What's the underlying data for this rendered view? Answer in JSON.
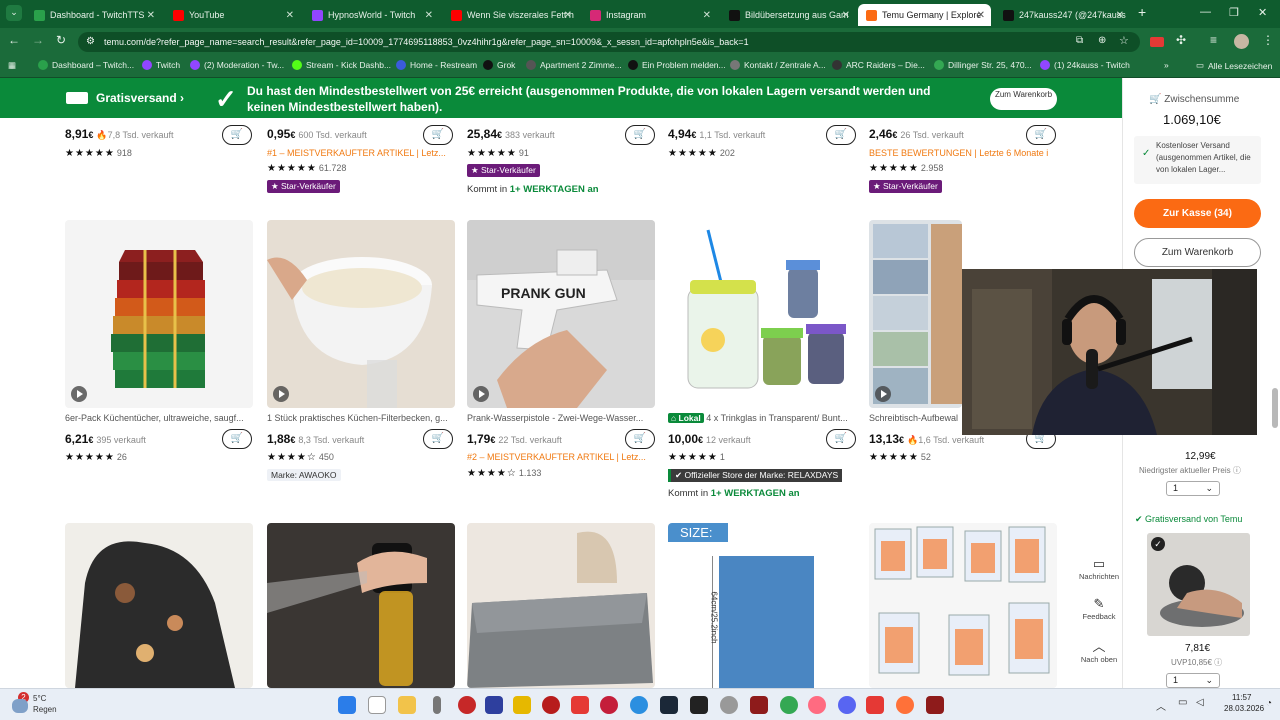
{
  "browser": {
    "tabs": [
      {
        "title": "Dashboard - TwitchTTS",
        "color": "#2aa14b"
      },
      {
        "title": "YouTube",
        "color": "#ff0000"
      },
      {
        "title": "HypnosWorld - Twitch",
        "color": "#9146ff"
      },
      {
        "title": "Wenn Sie viszerales Fett h",
        "color": "#ff0000"
      },
      {
        "title": "Instagram",
        "color": "#d62976"
      },
      {
        "title": "Bildübersetzung aus Gam",
        "color": "#111111"
      },
      {
        "title": "Temu Germany | Explore",
        "color": "#fb6a13"
      },
      {
        "title": "247kauss247 (@247kauss",
        "color": "#111111"
      }
    ],
    "url": "temu.com/de?refer_page_name=search_result&refer_page_id=10009_1774695118853_0vz4hihr1g&refer_page_sn=10009&_x_sessn_id=apfohpln5e&is_back=1",
    "bookmarks": [
      {
        "label": "Dashboard – Twitch...",
        "color": "#2aa14b"
      },
      {
        "label": "Twitch",
        "color": "#9146ff"
      },
      {
        "label": "(2) Moderation - Tw...",
        "color": "#9146ff"
      },
      {
        "label": "Stream - Kick Dashb...",
        "color": "#53fc18"
      },
      {
        "label": "Home - Restream",
        "color": "#3b5bdb"
      },
      {
        "label": "Grok",
        "color": "#111111"
      },
      {
        "label": "Apartment 2 Zimme...",
        "color": "#555555"
      },
      {
        "label": "Ein Problem melden...",
        "color": "#111111"
      },
      {
        "label": "Kontakt / Zentrale A...",
        "color": "#777777"
      },
      {
        "label": "ARC Raiders – Die...",
        "color": "#333333"
      },
      {
        "label": "Dillinger Str. 25, 470...",
        "color": "#34a853"
      },
      {
        "label": "(1) 24kauss - Twitch",
        "color": "#9146ff"
      }
    ],
    "bookmarks_more": "»",
    "all_bookmarks": "Alle Lesezeichen"
  },
  "banner": {
    "left": "Gratisversand",
    "message": "Du hast den Mindestbestellwert von 25€ erreicht (ausgenommen Produkte, die von lokalen Lagern versandt werden und keinen Mindestbestellwert haben).",
    "cart_button": "Zum Warenkorb"
  },
  "top_row": [
    {
      "price_main": "8,91",
      "price_unit": "€",
      "sold": "7,8 Tsd. verkauft",
      "reviews": "918",
      "cart_icon": "cart-plus-icon"
    },
    {
      "price_main": "0,95",
      "price_unit": "€",
      "sold": "600 Tsd. verkauft",
      "badge": "#1 – MEISTVERKAUFTER ARTIKEL | Letz...",
      "reviews": "61.728",
      "star_seller": "Star-Verkäufer"
    },
    {
      "price_main": "25,84",
      "price_unit": "€",
      "sold": "383 verkauft",
      "reviews": "91",
      "star_seller": "Star-Verkäufer",
      "delivery_prefix": "Kommt in",
      "delivery_days": "1+ WERKTAGEN an"
    },
    {
      "price_main": "4,94",
      "price_unit": "€",
      "sold": "1,1 Tsd. verkauft",
      "reviews": "202"
    },
    {
      "price_main": "2,46",
      "price_unit": "€",
      "sold": "26 Tsd. verkauft",
      "badge": "BESTE BEWERTUNGEN | Letzte 6 Monate i",
      "reviews": "2.958",
      "star_seller": "Star-Verkäufer"
    }
  ],
  "middle_row": [
    {
      "title": "6er-Pack Küchentücher, ultraweiche, saugf...",
      "price_main": "6,21",
      "price_unit": "€",
      "sold": "395 verkauft",
      "reviews": "26"
    },
    {
      "title": "1 Stück praktisches Küchen-Filterbecken, g...",
      "price_main": "1,88",
      "price_unit": "€",
      "sold": "8,3 Tsd. verkauft",
      "reviews": "450",
      "brand": "Marke: AWAOKO"
    },
    {
      "title": "Prank-Wasserpistole - Zwei-Wege-Wasser...",
      "price_main": "1,79",
      "price_unit": "€",
      "sold": "22 Tsd. verkauft",
      "badge": "#2 – MEISTVERKAUFTER ARTIKEL | Letz...",
      "reviews": "1.133",
      "gun_text": "PRANK GUN"
    },
    {
      "local_tag": "Lokal",
      "title": "4 x Trinkglas in Transparent/ Bunt...",
      "price_main": "10,00",
      "price_unit": "€",
      "sold": "12 verkauft",
      "reviews": "1",
      "official_store": "Offizieller Store der Marke: RELAXDAYS",
      "delivery_prefix": "Kommt in",
      "delivery_days": "1+ WERKTAGEN an"
    },
    {
      "title": "Schreibtisch-Aufbewal",
      "price_main": "13,13",
      "price_unit": "€",
      "sold": "1,6 Tsd. verkauft",
      "reviews": "52"
    }
  ],
  "bottom_row": [
    {
      "name": "oven-mitt"
    },
    {
      "name": "oil-sprayer"
    },
    {
      "name": "grey-blanket"
    },
    {
      "name": "size-chart",
      "size_label": "SIZE:",
      "dimension": "64cm/25.2inch"
    },
    {
      "name": "patch-sheets"
    }
  ],
  "sidebar": {
    "subtotal_label": "Zwischensumme",
    "subtotal": "1.069,10€",
    "free_shipping_note": "Kostenloser Versand (ausgenommen Artikel, die von lokalen Lager...",
    "checkout": "Zur Kasse (34)",
    "to_cart": "Zum Warenkorb",
    "item1_price": "12,99€",
    "lowest_price": "Niedrigster aktueller Preis",
    "item1_qty": "1",
    "free_shipping_temu": "Gratisversand von Temu",
    "item2_price": "7,81€",
    "item2_uvp": "UVP10,85€",
    "item2_qty": "1"
  },
  "floating": {
    "messages": "Nachrichten",
    "feedback": "Feedback",
    "top": "Nach oben"
  },
  "taskbar": {
    "weather_temp": "5°C",
    "weather_desc": "Regen",
    "notif_count": "2",
    "time": "11:57",
    "date": "28.03.2026"
  },
  "colors": {
    "temu_green": "#0a8a3a",
    "temu_orange": "#fb6a13",
    "chrome_green": "#0f5c2e",
    "star_seller_purple": "#6b1b79"
  }
}
